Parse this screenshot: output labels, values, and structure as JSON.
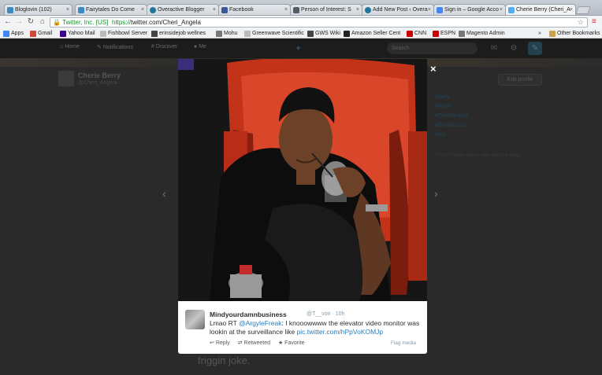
{
  "browser": {
    "tabs": [
      {
        "title": "Bloglovin (102)",
        "color": "#3b88c3"
      },
      {
        "title": "Fairytales Do Come",
        "color": "#3b88c3"
      },
      {
        "title": "Overactive Blogger",
        "color": "#21759b"
      },
      {
        "title": "Facebook",
        "color": "#3b5998"
      },
      {
        "title": "Person of Interest: S",
        "color": "#555b66"
      },
      {
        "title": "Add New Post ‹ Overa",
        "color": "#21759b"
      },
      {
        "title": "Sign in – Google Acco",
        "color": "#4285f4"
      },
      {
        "title": "Cherie Berry (Cheri_A",
        "color": "#55acee"
      }
    ],
    "ev_label": "Twitter, Inc. [US]",
    "url_scheme": "https://",
    "url_rest": "twitter.com/Cheri_Angela",
    "bookmarks": [
      {
        "label": "Apps",
        "color": "#4285f4"
      },
      {
        "label": "Gmail",
        "color": "#d14836"
      },
      {
        "label": "Yahoo Mail",
        "color": "#400090"
      },
      {
        "label": "Fishbowl Server",
        "color": "#999999"
      },
      {
        "label": "erinsidejob wellnes",
        "color": "#444444"
      },
      {
        "label": "Mohu",
        "color": "#777777"
      },
      {
        "label": "Greenwave Scientific",
        "color": "#999999"
      },
      {
        "label": "GWS Wiki",
        "color": "#444444"
      },
      {
        "label": "Amazon Seller Cent",
        "color": "#222222"
      },
      {
        "label": "CNN",
        "color": "#cc0000"
      },
      {
        "label": "ESPN",
        "color": "#cc0000"
      },
      {
        "label": "Magento Admin",
        "color": "#777777"
      }
    ],
    "other_bookmarks": "Other Bookmarks",
    "more_bookmarks": "»"
  },
  "twitter": {
    "nav": {
      "home": "Home",
      "notifications": "Notifications",
      "discover": "Discover",
      "me": "Me",
      "search_placeholder": "Search"
    },
    "profile": {
      "name": "Cherie Berry",
      "handle": "@Cheri_Angela",
      "edit_label": "Edit profile"
    },
    "trends": [
      "Miami",
      "#oomf",
      "#TheBlacklist",
      "#GoHabsGo",
      "Nets"
    ],
    "footer": "© 2014 Twitter   About   Help   Ads   Our Blog",
    "timeline_text": "friggin joke."
  },
  "modal": {
    "close": "×",
    "prev": "‹",
    "next": "›",
    "tweet": {
      "name": "Mindyourdamnbusiness",
      "handle": "@T__von",
      "time": "· 10h",
      "text_prefix": "Lmao RT ",
      "mention": "@ArgyleFreak",
      "text_body": ": I knooowwww the elevator video monitor was lookin at the surveillance like ",
      "link": "pic.twitter.com/hPpVoKOMJp",
      "reply": "Reply",
      "retweeted": "Retweeted",
      "favorite": "Favorite",
      "flag": "Flag media"
    }
  }
}
